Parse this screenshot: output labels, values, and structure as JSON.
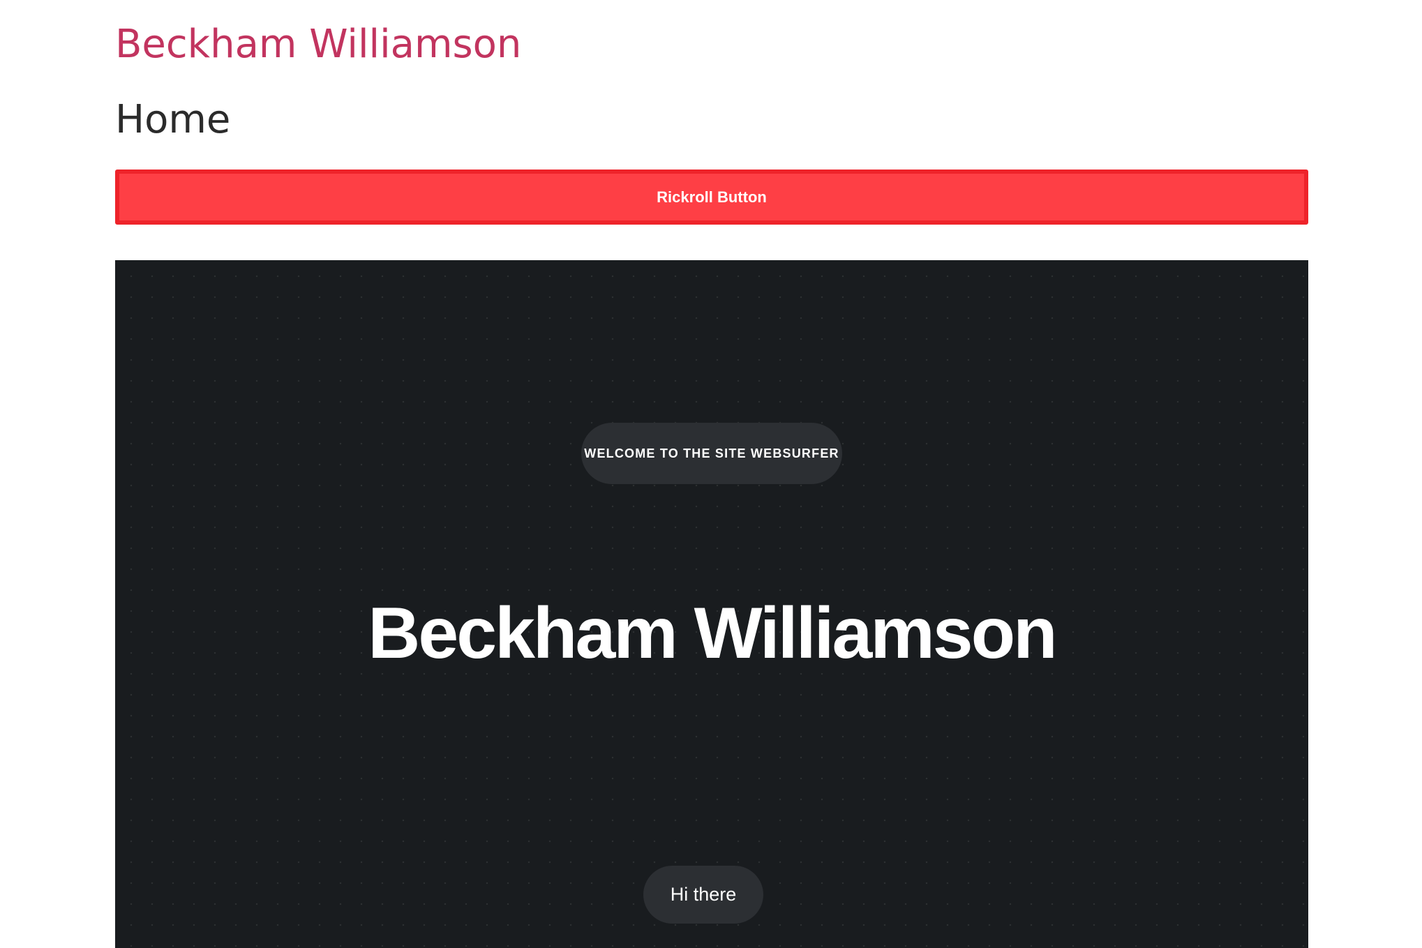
{
  "header": {
    "site_title": "Beckham Williamson",
    "page_heading": "Home"
  },
  "rickroll": {
    "label": "Rickroll Button"
  },
  "hero": {
    "welcome_badge": "WELCOME TO THE SITE WEBSURFER",
    "name": "Beckham Williamson",
    "greeting_button": "Hi there"
  },
  "colors": {
    "site_title": "#c2345f",
    "rickroll_fill": "#fe3f45",
    "rickroll_border": "#ee232a",
    "hero_background": "#191c1f",
    "pill_background": "#2c2f33"
  }
}
